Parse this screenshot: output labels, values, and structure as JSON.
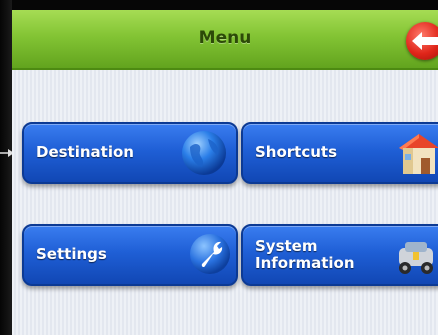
{
  "header": {
    "title": "Menu",
    "back_icon": "back-arrow-icon"
  },
  "menu": {
    "items": [
      {
        "label": "Destination",
        "icon": "globe-icon"
      },
      {
        "label": "Shortcuts",
        "icon": "house-icon"
      },
      {
        "label": "Settings",
        "icon": "wrench-icon"
      },
      {
        "label_line1": "System",
        "label_line2": "Information",
        "icon": "vehicle-icon"
      }
    ]
  },
  "colors": {
    "header_green": "#83c434",
    "tile_blue": "#1f5fd6",
    "back_red": "#e0261a"
  }
}
